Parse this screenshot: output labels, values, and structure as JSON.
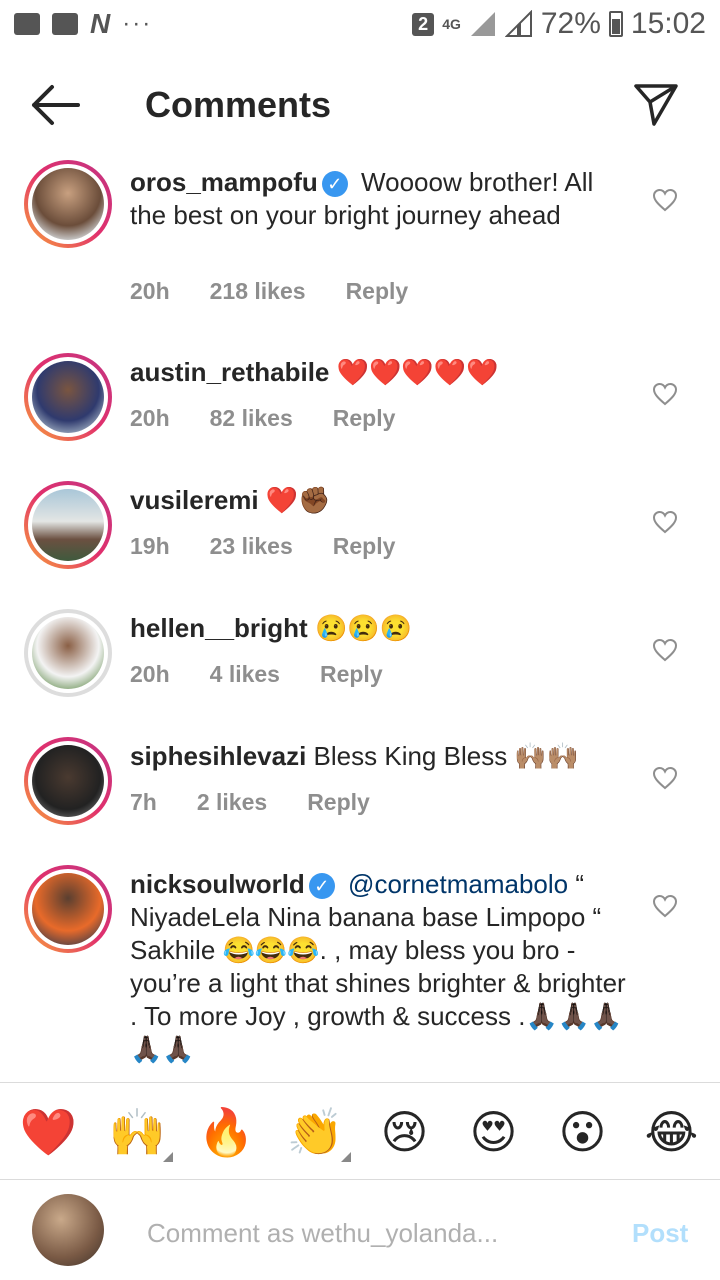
{
  "status_bar": {
    "sim": "2",
    "network": "4G",
    "battery": "72%",
    "time": "15:02",
    "dots": "···",
    "n_logo": "N"
  },
  "header": {
    "title": "Comments"
  },
  "comments": [
    {
      "username": "oros_mampofu",
      "verified": true,
      "text": "Woooow brother! All the best on your bright journey ahead",
      "time": "20h",
      "likes": "218 likes",
      "reply": "Reply"
    },
    {
      "username": "austin_rethabile",
      "verified": false,
      "text": "❤️❤️❤️❤️❤️",
      "time": "20h",
      "likes": "82 likes",
      "reply": "Reply"
    },
    {
      "username": "vusileremi",
      "verified": false,
      "text": "❤️✊🏾",
      "time": "19h",
      "likes": "23 likes",
      "reply": "Reply"
    },
    {
      "username": "hellen__bright",
      "verified": false,
      "text": "😢😢😢",
      "time": "20h",
      "likes": "4 likes",
      "reply": "Reply"
    },
    {
      "username": "siphesihlevazi",
      "verified": false,
      "text": "Bless King Bless 🙌🏽🙌🏽",
      "time": "7h",
      "likes": "2 likes",
      "reply": "Reply"
    },
    {
      "username": "nicksoulworld",
      "verified": true,
      "mention": "@cornetmamabolo",
      "text": "“ NiyadeLela Nina banana base Limpopo “ Sakhile 😂😂😂. , may bless you bro - you’re a light that shines brighter & brighter . To more Joy , growth & success .🙏🏿🙏🏿🙏🏿🙏🏿🙏🏿"
    }
  ],
  "emoji_bar": [
    "❤️",
    "🙌",
    "🔥",
    "👏",
    "😢",
    "😍",
    "😮",
    "😂"
  ],
  "composer": {
    "placeholder": "Comment as wethu_yolanda...",
    "post_label": "Post"
  },
  "colors": {
    "accent_blue": "#3897f0",
    "post_disabled": "#b2dffc",
    "meta_gray": "#8e8e8e"
  }
}
